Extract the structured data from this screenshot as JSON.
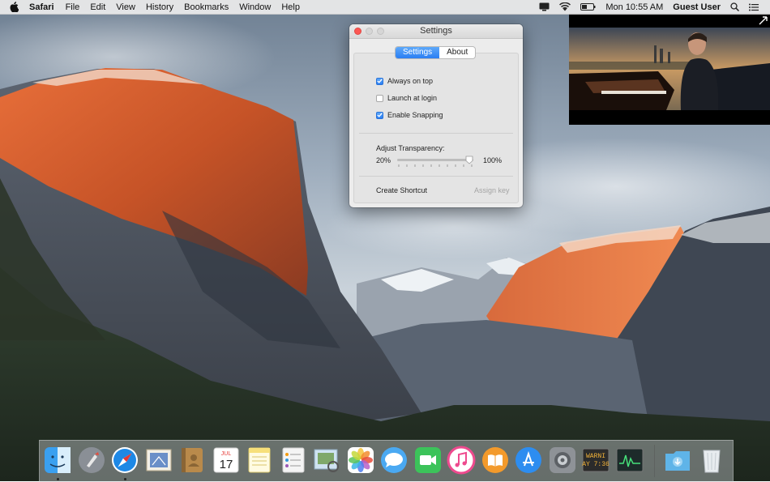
{
  "menubar": {
    "app_name": "Safari",
    "menus": [
      "File",
      "Edit",
      "View",
      "History",
      "Bookmarks",
      "Window",
      "Help"
    ],
    "clock": "Mon 10:55 AM",
    "user": "Guest User",
    "status_icons": [
      "display-icon",
      "wifi-icon",
      "battery-icon",
      "spotlight-icon",
      "notification-center-icon"
    ]
  },
  "settings_window": {
    "title": "Settings",
    "tabs": [
      {
        "label": "Settings",
        "active": true
      },
      {
        "label": "About",
        "active": false
      }
    ],
    "options": [
      {
        "label": "Always on top",
        "checked": true
      },
      {
        "label": "Launch at login",
        "checked": false
      },
      {
        "label": "Enable Snapping",
        "checked": true
      }
    ],
    "transparency": {
      "label": "Adjust Transparency:",
      "min_label": "20%",
      "max_label": "100%",
      "value_percent": 95
    },
    "shortcut": {
      "label": "Create Shortcut",
      "placeholder": "Assign key"
    }
  },
  "dock": {
    "apps": [
      {
        "name": "Finder",
        "running": true,
        "color": "#3aa0f0"
      },
      {
        "name": "Launchpad",
        "running": false,
        "color": "#8a8f96"
      },
      {
        "name": "Safari",
        "running": true,
        "color": "#1e88e5"
      },
      {
        "name": "Mail",
        "running": false,
        "color": "#6a8fc8"
      },
      {
        "name": "Contacts",
        "running": false,
        "color": "#b98a4b"
      },
      {
        "name": "Calendar",
        "running": false,
        "color": "#ffffff",
        "month": "JUL",
        "day": "17"
      },
      {
        "name": "Notes",
        "running": false,
        "color": "#f7e07a"
      },
      {
        "name": "Reminders",
        "running": false,
        "color": "#f4f4f4"
      },
      {
        "name": "Preview",
        "running": false,
        "color": "#cfe3f2"
      },
      {
        "name": "Photos",
        "running": false,
        "color": "#ffffff"
      },
      {
        "name": "Messages",
        "running": false,
        "color": "#4aa9f2"
      },
      {
        "name": "FaceTime",
        "running": false,
        "color": "#3cc35a"
      },
      {
        "name": "iTunes",
        "running": false,
        "color": "#ee4a8e"
      },
      {
        "name": "iBooks",
        "running": false,
        "color": "#f39a2b"
      },
      {
        "name": "App Store",
        "running": false,
        "color": "#2d8df0"
      },
      {
        "name": "System Preferences",
        "running": false,
        "color": "#8e9297"
      },
      {
        "name": "Console",
        "running": false,
        "color": "#2b2b2b",
        "text": "WARNI\nAY 7:36"
      },
      {
        "name": "Activity Monitor",
        "running": false,
        "color": "#1d2b2a"
      },
      {
        "name": "Downloads",
        "running": false,
        "color": "#5fb4e8"
      },
      {
        "name": "Trash",
        "running": false,
        "color": "#e8ecef"
      }
    ]
  },
  "colors": {
    "accent": "#2a7ef3",
    "close_button": "#fc5753"
  }
}
